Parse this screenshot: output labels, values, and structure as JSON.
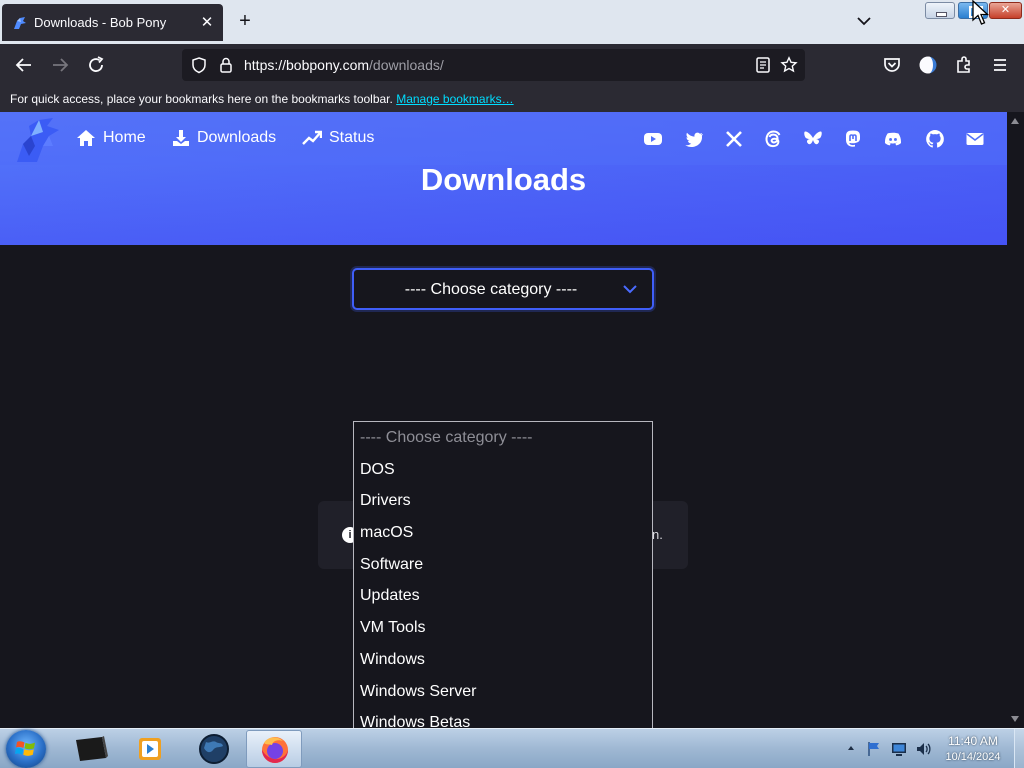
{
  "browser": {
    "tab_title": "Downloads - Bob Pony",
    "tab_close": "✕",
    "new_tab": "+",
    "url_host": "https://bobpony.com",
    "url_path": "/downloads/",
    "bookmarks_prompt": "For quick access, place your bookmarks here on the bookmarks toolbar.",
    "bookmarks_link": "Manage bookmarks…"
  },
  "window_buttons": {
    "close": "✕"
  },
  "site": {
    "nav": [
      {
        "label": "Home",
        "icon": "home-icon"
      },
      {
        "label": "Downloads",
        "icon": "download-icon"
      },
      {
        "label": "Status",
        "icon": "trending-up-icon"
      }
    ],
    "social_icons": [
      "youtube-icon",
      "twitter-bird-icon",
      "x-icon",
      "threads-icon",
      "bluesky-icon",
      "mastodon-icon",
      "discord-icon",
      "github-icon",
      "mail-icon"
    ],
    "heading": "Downloads",
    "accent": "#3f5ef8"
  },
  "category_select": {
    "selected": "---- Choose category ----",
    "options": [
      "---- Choose category ----",
      "DOS",
      "Drivers",
      "macOS",
      "Software",
      "Updates",
      "VM Tools",
      "Windows",
      "Windows Server",
      "Windows Betas"
    ]
  },
  "info_card": {
    "icon_glyph": "i",
    "visible_tail": "n."
  },
  "taskbar": {
    "apps": [
      "terminal-icon",
      "media-player-icon",
      "globe-icon",
      "firefox-icon"
    ],
    "time": "11:40 AM",
    "date": "10/14/2024"
  }
}
